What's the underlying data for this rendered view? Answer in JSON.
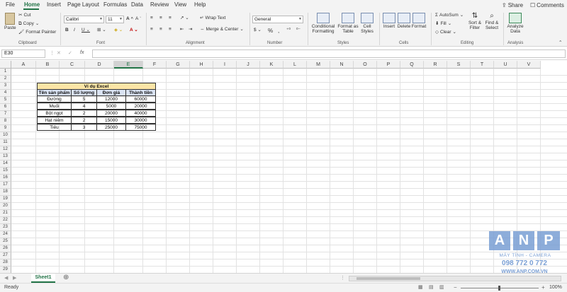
{
  "menu": {
    "tabs": [
      "File",
      "Home",
      "Insert",
      "Page Layout",
      "Formulas",
      "Data",
      "Review",
      "View",
      "Help"
    ],
    "active": "Home",
    "share": "Share",
    "comments": "Comments"
  },
  "ribbon": {
    "clipboard": {
      "paste": "Paste",
      "cut": "Cut",
      "copy": "Copy",
      "format_painter": "Format Painter",
      "label": "Clipboard"
    },
    "font": {
      "name": "Calibri",
      "size": "11",
      "label": "Font"
    },
    "alignment": {
      "wrap": "Wrap Text",
      "merge": "Merge & Center",
      "label": "Alignment"
    },
    "number": {
      "format": "General",
      "label": "Number"
    },
    "styles": {
      "conditional": "Conditional Formatting",
      "format_table": "Format as Table",
      "cell_styles": "Cell Styles",
      "label": "Styles"
    },
    "cells": {
      "insert": "Insert",
      "delete": "Delete",
      "format": "Format",
      "label": "Cells"
    },
    "editing": {
      "autosum": "AutoSum",
      "fill": "Fill",
      "clear": "Clear",
      "sort": "Sort & Filter",
      "find": "Find & Select",
      "label": "Editing"
    },
    "analysis": {
      "analyze": "Analyze Data",
      "label": "Analysis"
    }
  },
  "formula_bar": {
    "name_box": "E30",
    "fx": "fx",
    "formula": ""
  },
  "columns": [
    "A",
    "B",
    "C",
    "D",
    "E",
    "F",
    "G",
    "H",
    "I",
    "J",
    "K",
    "L",
    "M",
    "N",
    "O",
    "P",
    "Q",
    "R",
    "S",
    "T",
    "U",
    "V"
  ],
  "selected_column": "E",
  "rows": [
    "1",
    "2",
    "3",
    "4",
    "5",
    "6",
    "7",
    "8",
    "9",
    "10",
    "11",
    "12",
    "13",
    "14",
    "15",
    "16",
    "17",
    "18",
    "19",
    "20",
    "21",
    "22",
    "23",
    "24",
    "25",
    "26",
    "27",
    "28",
    "29"
  ],
  "table": {
    "title": "Ví dụ Excel",
    "headers": [
      "Tên sản phẩm",
      "Số lượng",
      "Đơn giá",
      "Thành tiền"
    ],
    "rows": [
      [
        "Đường",
        "5",
        "12000",
        "60000"
      ],
      [
        "Muối",
        "4",
        "5000",
        "20000"
      ],
      [
        "Bột ngọt",
        "2",
        "20000",
        "40000"
      ],
      [
        "Hạt niêm",
        "2",
        "15000",
        "30000"
      ],
      [
        "Tiêu",
        "3",
        "25000",
        "75000"
      ]
    ]
  },
  "sheet_tabs": [
    "Sheet1"
  ],
  "status": {
    "ready": "Ready",
    "zoom": "100%"
  },
  "watermark": {
    "letters": [
      "A",
      "N",
      "P"
    ],
    "line1": "MÁY TÍNH - CAMERA",
    "phone": "098 772 0 772",
    "url": "WWW.ANP.COM.VN"
  },
  "colors": {
    "accent": "#217346",
    "header_fill": "#dae3f3",
    "title_fill": "#fbe5a6",
    "watermark": "#7a9fd4"
  }
}
